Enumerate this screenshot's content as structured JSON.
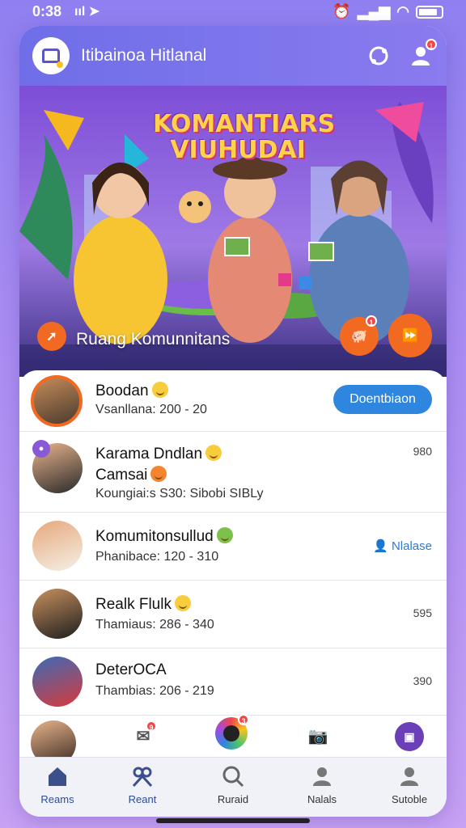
{
  "status": {
    "time": "0:38",
    "signal_left": "ııl ➤"
  },
  "header": {
    "title": "Itibainoa Hitlanal"
  },
  "hero": {
    "title_line1": "KOMANTIARS",
    "title_line2": "VIUHUDAI",
    "caption": "Ruang Komunnitans"
  },
  "rows": [
    {
      "name": "Boodan",
      "sub": "Vsanllana: 200 - 20",
      "button": "Doentbiaon"
    },
    {
      "name_line1": "Karama Dndlan",
      "name_line2": "Camsai",
      "sub": "Koungiai:s S30: Sibobi SIBLy",
      "meta": "980"
    },
    {
      "name": "Komumitonsullud",
      "sub": "Phanibace: 120 - 310",
      "action": "Nlalase"
    },
    {
      "name": "Realk Flulk",
      "sub": "Thamiaus: 286 - 340",
      "meta": "595"
    },
    {
      "name": "DeterOCA",
      "sub": "Thambias: 206 - 219",
      "meta": "390"
    }
  ],
  "tabs": [
    {
      "label": "Reams",
      "icon": "home-icon"
    },
    {
      "label": "Reant",
      "icon": "people-icon"
    },
    {
      "label": "Ruraid",
      "icon": "search-icon"
    },
    {
      "label": "Nalals",
      "icon": "user-icon"
    },
    {
      "label": "Sutoble",
      "icon": "profile-icon"
    }
  ],
  "colors": {
    "accent": "#2e86de",
    "header": "#6f6ee8",
    "orange": "#f26a21"
  },
  "badges": {
    "notification": "1",
    "quick_notif": "9",
    "quick_center": "3"
  }
}
